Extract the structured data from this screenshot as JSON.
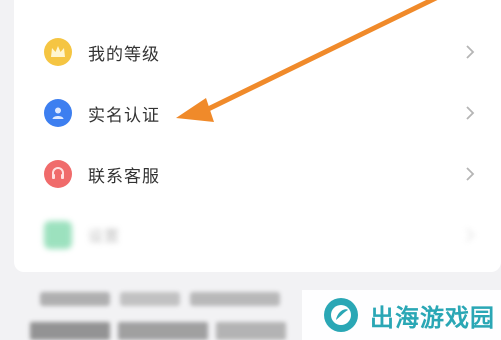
{
  "menu": {
    "items": [
      {
        "label": "我的等级",
        "icon": "crown-icon",
        "icon_color": "#f5c542"
      },
      {
        "label": "实名认证",
        "icon": "user-id-icon",
        "icon_color": "#3d7ff0"
      },
      {
        "label": "联系客服",
        "icon": "customer-service-icon",
        "icon_color": "#f06b6b"
      },
      {
        "label": "设置",
        "icon": "settings-icon",
        "icon_color": "#4cc98a"
      }
    ]
  },
  "annotation": {
    "arrow_color": "#f08a2a"
  },
  "watermark": {
    "text": "出海游戏园",
    "color": "#2aa7b5"
  }
}
